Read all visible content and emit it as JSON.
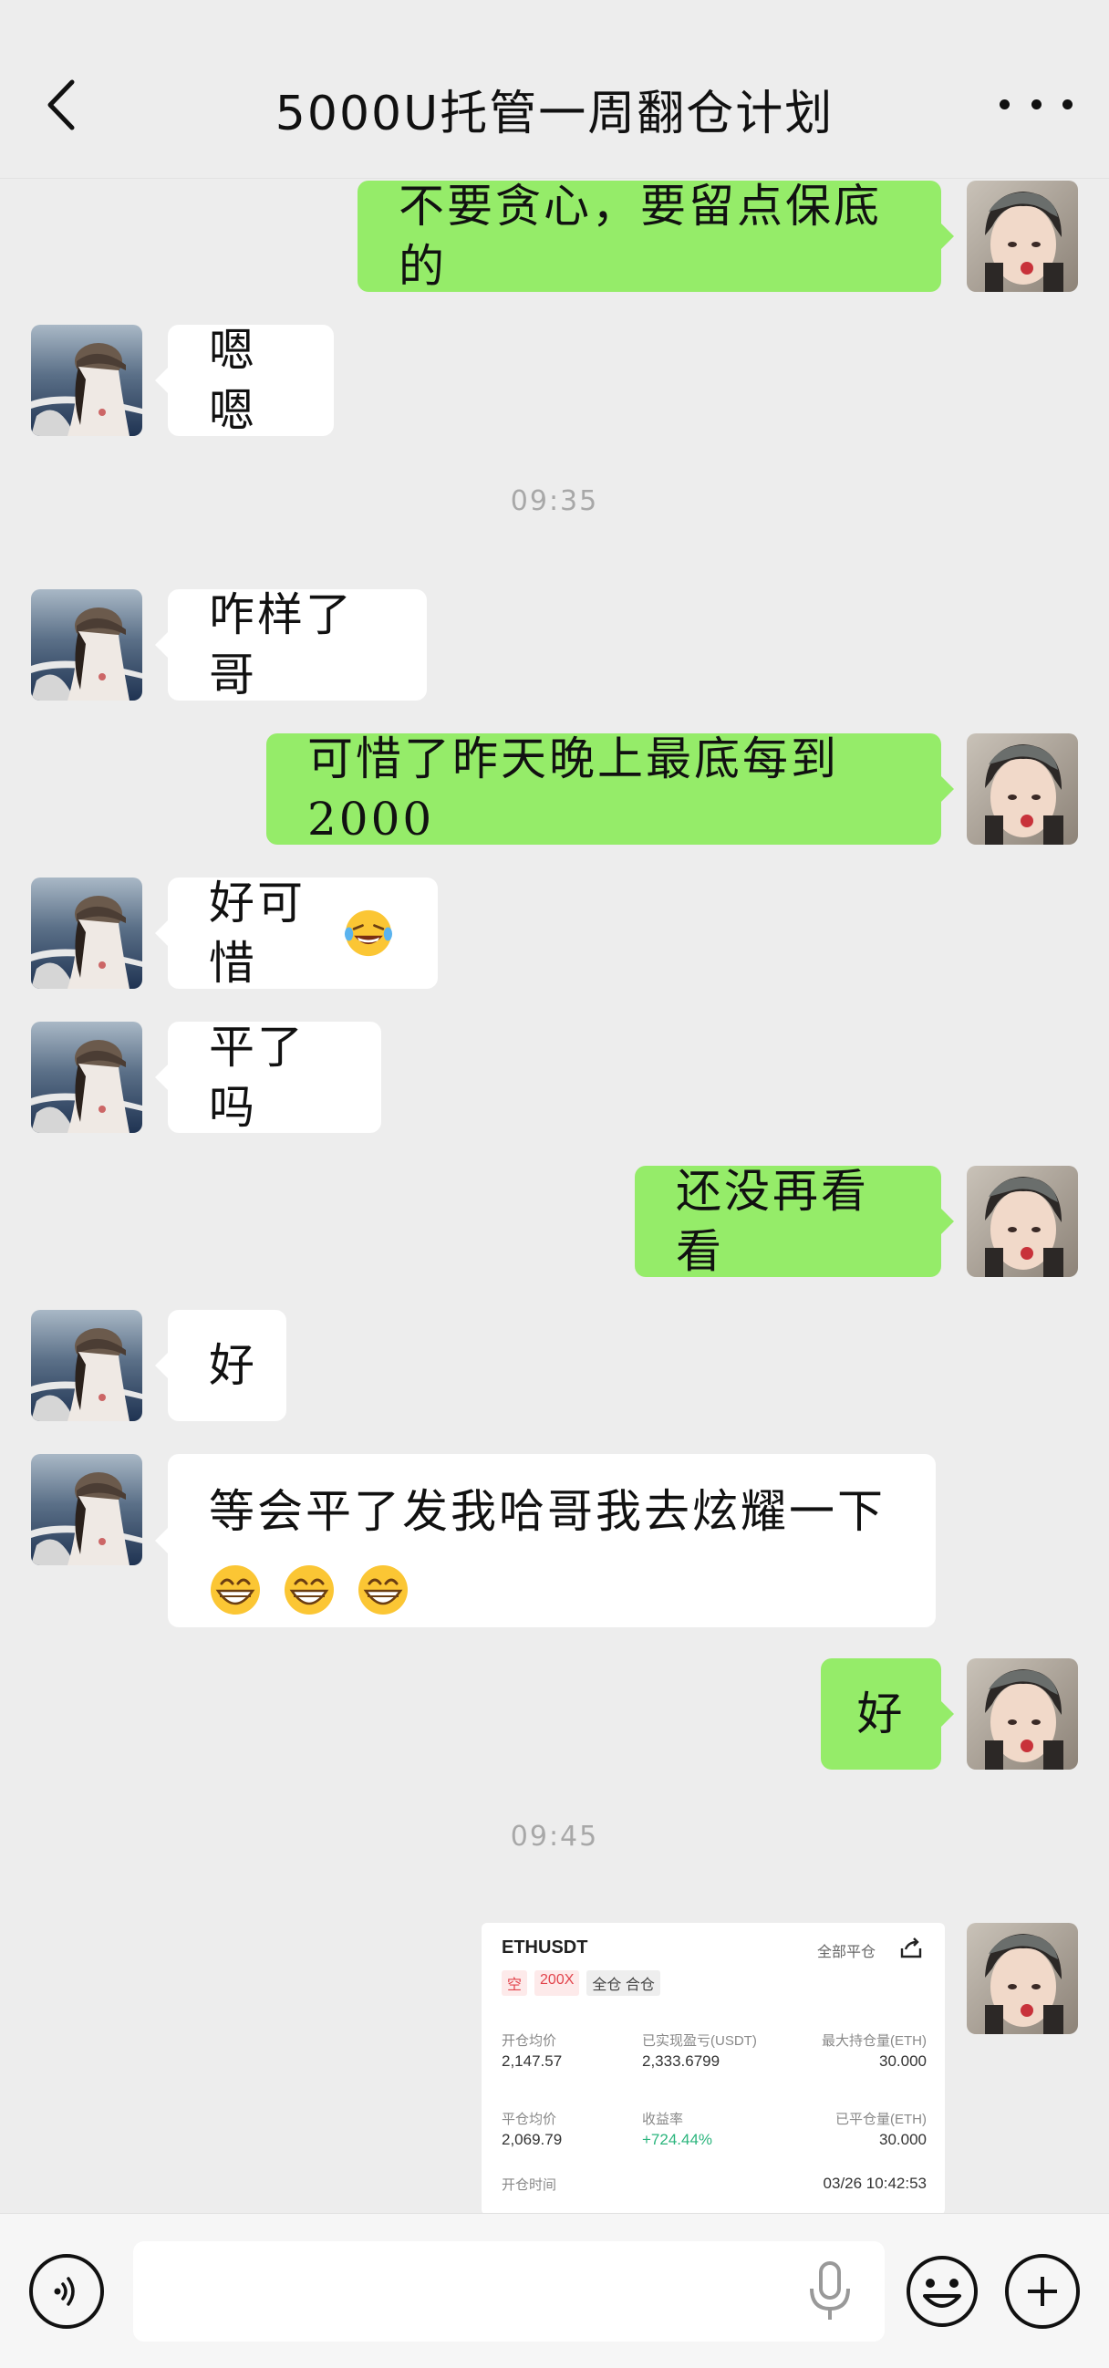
{
  "header": {
    "title": "5000U托管一周翻仓计划"
  },
  "messages": {
    "m1": "不要贪心，要留点保底的",
    "m2": "嗯嗯",
    "t1": "09:35",
    "m3": "咋样了哥",
    "m4": "可惜了昨天晚上最底每到2000",
    "m5": "好可惜",
    "m6": "平了吗",
    "m7": "还没再看看",
    "m8": "好",
    "m9": "等会平了发我哈哥我去炫耀一下",
    "m10": "好",
    "t2": "09:45"
  },
  "card": {
    "symbol": "ETHUSDT",
    "close_all": "全部平仓",
    "side": "空",
    "leverage": "200X",
    "margin_mode": "全仓 合仓",
    "open_avg_label": "开仓均价",
    "open_avg": "2,147.57",
    "realized_label": "已实现盈亏(USDT)",
    "realized": "2,333.6799",
    "max_pos_label": "最大持仓量(ETH)",
    "max_pos": "30.000",
    "close_avg_label": "平仓均价",
    "close_avg": "2,069.79",
    "roi_label": "收益率",
    "roi": "+724.44%",
    "closed_label": "已平仓量(ETH)",
    "closed": "30.000",
    "open_time_label": "开仓时间",
    "open_time": "03/26 10:42:53"
  },
  "colors": {
    "green_bubble": "#95ec69",
    "white_bubble": "#ffffff",
    "background": "#ededed",
    "profit": "#2bb57d",
    "short": "#e2444c"
  },
  "icons": [
    "back-icon",
    "more-icon",
    "voice-icon",
    "mic-icon",
    "emoji-icon",
    "plus-icon",
    "share-icon"
  ]
}
